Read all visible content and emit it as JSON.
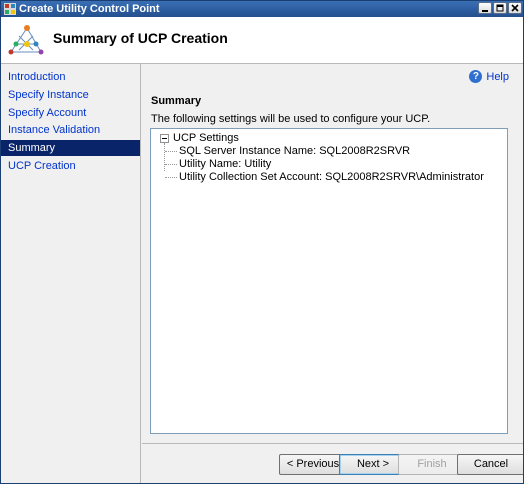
{
  "window": {
    "title": "Create Utility Control Point"
  },
  "titlebar_buttons": {
    "minimize": "_",
    "maximize": "□",
    "close": "×"
  },
  "header": {
    "title": "Summary of UCP Creation",
    "logo_icon": "ucp-wizard-logo"
  },
  "sidebar": {
    "items": [
      {
        "label": "Introduction",
        "active": false
      },
      {
        "label": "Specify Instance",
        "active": false
      },
      {
        "label": "Specify Account",
        "active": false
      },
      {
        "label": "Instance Validation",
        "active": false
      },
      {
        "label": "Summary",
        "active": true
      },
      {
        "label": "UCP Creation",
        "active": false
      }
    ]
  },
  "content": {
    "help_label": "Help",
    "section_title": "Summary",
    "description": "The following settings will be used to configure your UCP.",
    "tree": {
      "root_label": "UCP Settings",
      "children": [
        "SQL Server Instance Name: SQL2008R2SRVR",
        "Utility Name: Utility",
        "Utility Collection Set Account: SQL2008R2SRVR\\Administrator"
      ]
    }
  },
  "buttons": {
    "previous": "< Previous",
    "next": "Next >",
    "finish": "Finish",
    "cancel": "Cancel"
  },
  "colors": {
    "accent": "#0a246a",
    "link": "#0033cc",
    "titlebar": "#2a5b9e"
  }
}
